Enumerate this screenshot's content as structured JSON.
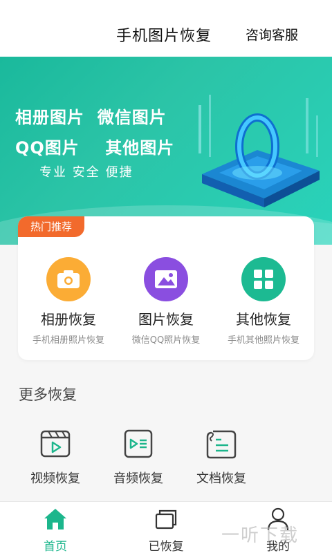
{
  "header": {
    "title": "手机图片恢复",
    "service": "咨询客服"
  },
  "banner": {
    "line1": "相册图片  微信图片",
    "line2": "QQ图片    其他图片",
    "slogan": "专业 安全 便捷"
  },
  "hot": {
    "badge": "热门推荐",
    "features": [
      {
        "name": "相册恢复",
        "desc": "手机相册照片恢复",
        "icon": "camera-icon",
        "color": "#fbac35"
      },
      {
        "name": "图片恢复",
        "desc": "微信QQ照片恢复",
        "icon": "image-icon",
        "color": "#8a4ee0"
      },
      {
        "name": "其他恢复",
        "desc": "手机其他照片恢复",
        "icon": "grid-icon",
        "color": "#1cba92"
      }
    ]
  },
  "more": {
    "title": "更多恢复",
    "items": [
      {
        "name": "视频恢复",
        "icon": "video-icon"
      },
      {
        "name": "音频恢复",
        "icon": "audio-icon"
      },
      {
        "name": "文档恢复",
        "icon": "document-icon"
      }
    ]
  },
  "tabs": [
    {
      "label": "首页",
      "icon": "home-icon",
      "active": true
    },
    {
      "label": "已恢复",
      "icon": "recovered-icon",
      "active": false
    },
    {
      "label": "我的",
      "icon": "profile-icon",
      "active": false
    }
  ],
  "watermark": "一听下载",
  "colors": {
    "accent": "#1cb68c",
    "badge": "#f26a2c"
  }
}
